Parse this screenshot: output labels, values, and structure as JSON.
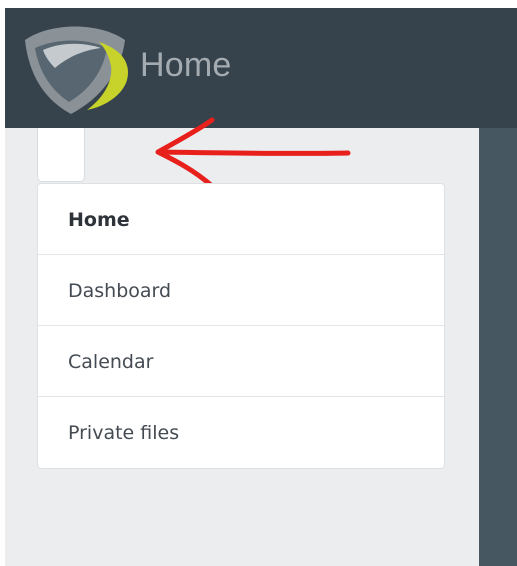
{
  "header": {
    "title": "Home"
  },
  "nav": {
    "items": [
      {
        "label": "Home",
        "active": true
      },
      {
        "label": "Dashboard",
        "active": false
      },
      {
        "label": "Calendar",
        "active": false
      },
      {
        "label": "Private files",
        "active": false
      }
    ]
  },
  "icons": {
    "logo": "shield-logo-icon",
    "drawer_toggle": "drawer-toggle-icon",
    "annotation": "red-arrow-left-icon"
  },
  "colors": {
    "header_bg": "#37434c",
    "logo_accent": "#c7d32a",
    "logo_dark": "#576670",
    "drawer_bg": "#ecedef",
    "annotation": "#e8201c"
  }
}
